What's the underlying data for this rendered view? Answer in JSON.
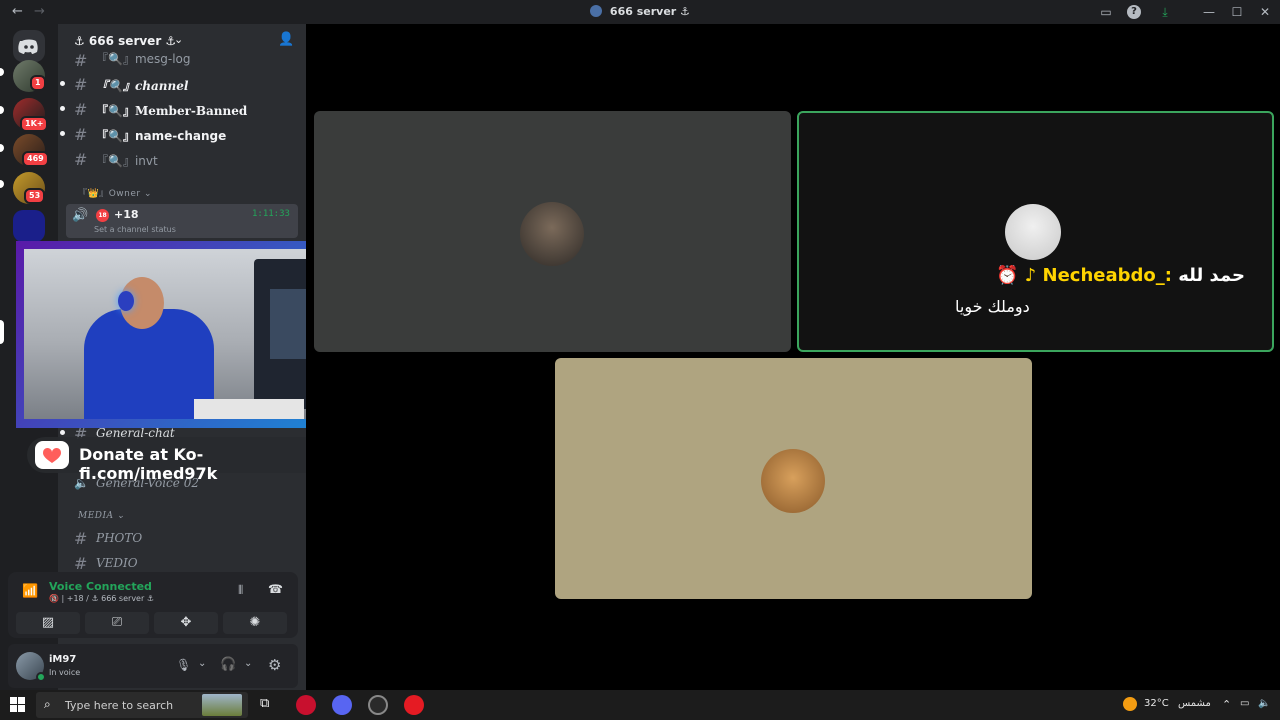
{
  "titlebar": {
    "back": "←",
    "forward": "→",
    "title": "666 server ⚓",
    "min": "—",
    "max": "☐",
    "close": "✕"
  },
  "guild_badges": [
    "1",
    "1K+",
    "469",
    "53"
  ],
  "server": {
    "name": "⚓ 666 server ⚓"
  },
  "channels": [
    {
      "name": "『🔍』mesg-log",
      "unread": false
    },
    {
      "name": "『🔍』channel",
      "unread": true
    },
    {
      "name": "『🔍』Member-Banned",
      "unread": true
    },
    {
      "name": "『🔍』name-change",
      "unread": true
    },
    {
      "name": "『🔍』invt",
      "unread": false
    }
  ],
  "owner_category": "『👑』Owner ⌄",
  "active_voice": {
    "name": "+18",
    "timer": "1:11:33",
    "status": "Set a channel status"
  },
  "general_channels": [
    {
      "name": "General-chat"
    },
    {
      "name": "General-Voice 02"
    }
  ],
  "media_category": "MEDIA ⌄",
  "media_channels": [
    {
      "name": "PHOTO"
    },
    {
      "name": "VEDIO"
    }
  ],
  "kofi": {
    "text": "Donate at Ko-fi.com/imed97k"
  },
  "voice_panel": {
    "status": "Voice Connected",
    "location": "🔞 | +18 / ⚓ 666 server ⚓"
  },
  "user": {
    "name": "iM97",
    "status": "In voice"
  },
  "stage": {
    "caption_name": "Necheabdo_:",
    "caption_arabic": "حمد لله",
    "caption_line2": "دوملك خويا"
  },
  "taskbar": {
    "search_placeholder": "Type here to search",
    "temperature": "32°C",
    "weather_word": "مشمس"
  },
  "colors": {
    "accent_green": "#23a55a",
    "speaking_border": "#3ba55d",
    "kofi_red": "#ff5e5b",
    "badge_red": "#f23f43"
  }
}
